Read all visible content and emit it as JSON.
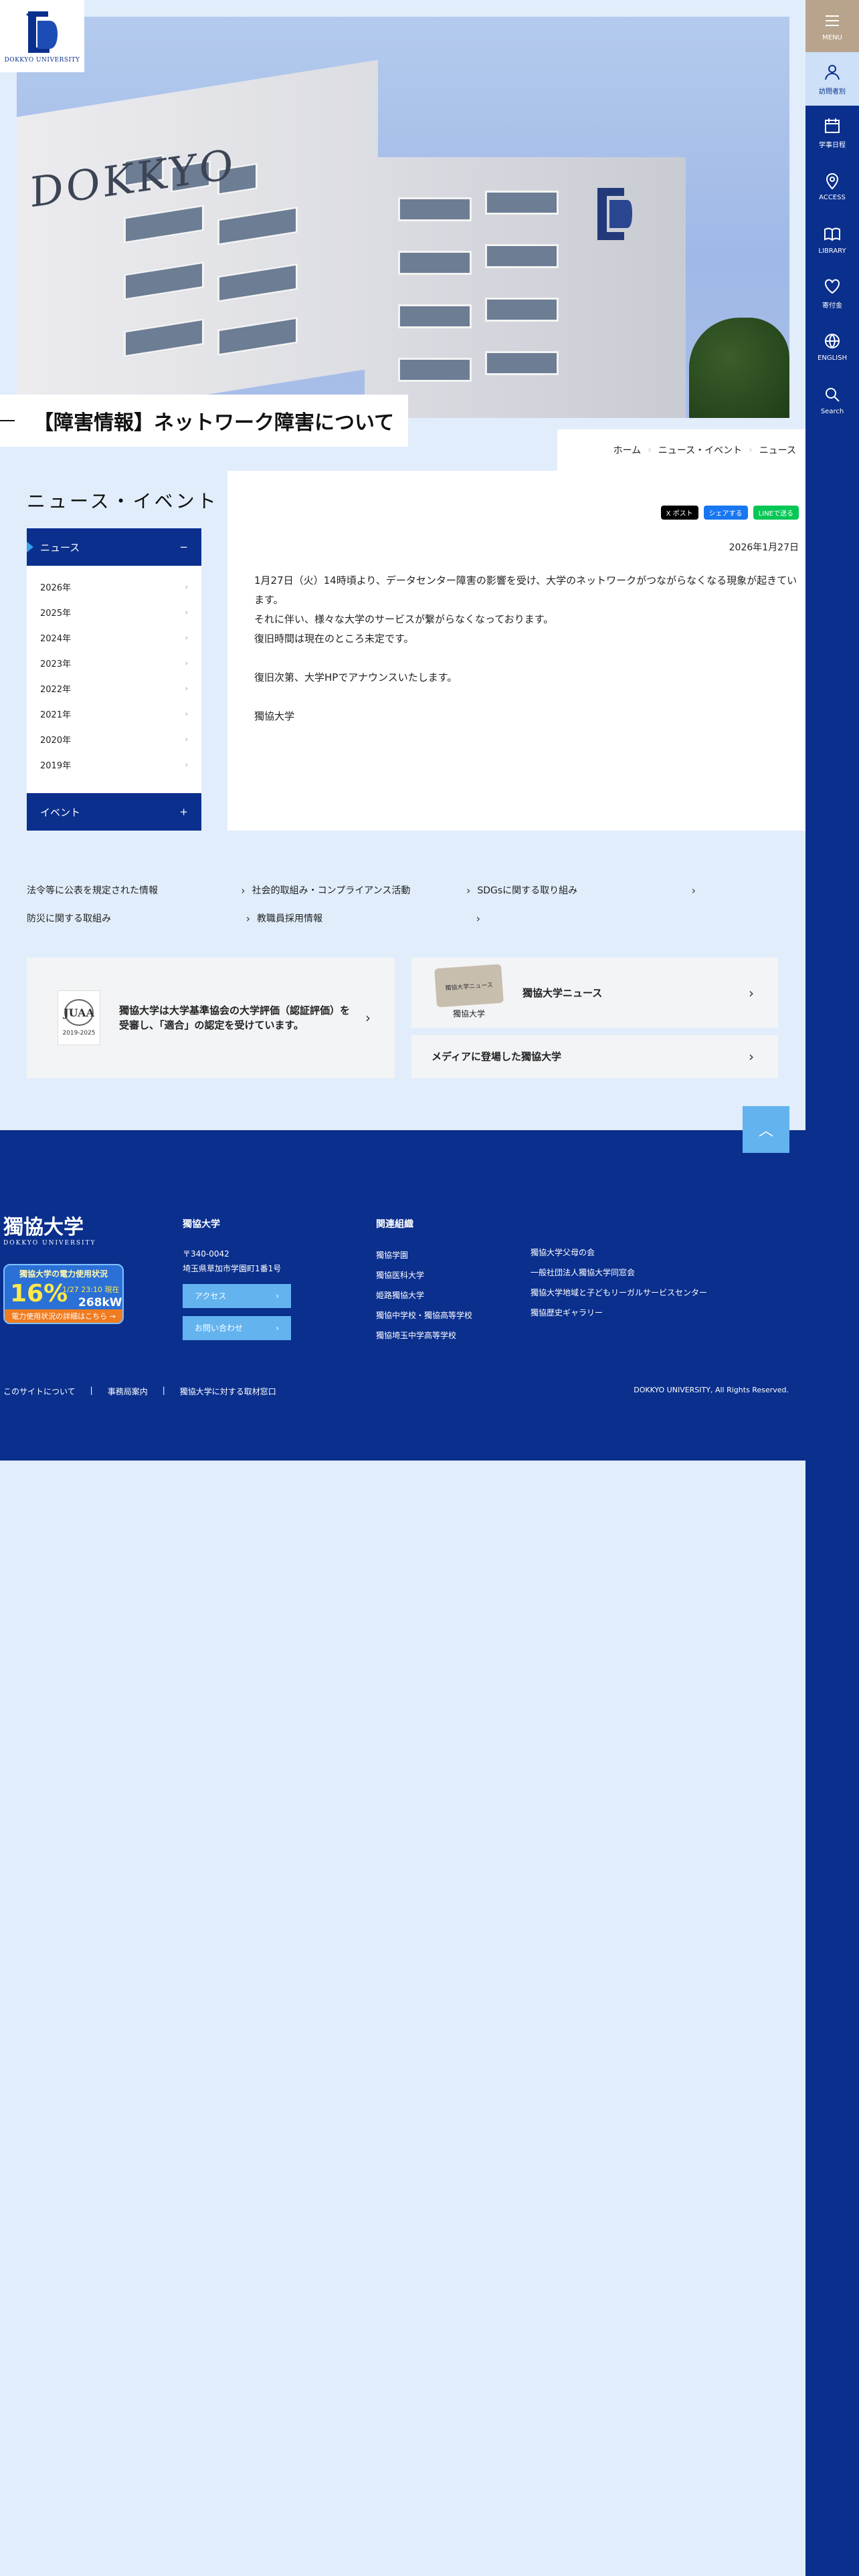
{
  "logo": {
    "text": "DOKKYO UNIVERSITY"
  },
  "nav": {
    "menu": "MENU",
    "visit": "訪問者別",
    "items": [
      "学事日程",
      "ACCESS",
      "LIBRARY",
      "寄付金",
      "ENGLISH",
      "Search"
    ]
  },
  "hero": {
    "building_text": "DOKKYO"
  },
  "page": {
    "title": "【障害情報】ネットワーク障害について"
  },
  "breadcrumb": [
    "ホーム",
    "ニュース・イベント",
    "ニュース"
  ],
  "sidebar": {
    "title": "ニュース・イベント",
    "categories": [
      {
        "label": "ニュース",
        "toggle": "−"
      },
      {
        "label": "イベント",
        "toggle": "+"
      }
    ],
    "years": [
      "2026年",
      "2025年",
      "2024年",
      "2023年",
      "2022年",
      "2021年",
      "2020年",
      "2019年"
    ]
  },
  "share": {
    "x": "X ポスト",
    "fb": "シェアする",
    "line": "LINEで送る",
    "colors": {
      "x": "#000000",
      "fb": "#1877f2",
      "line": "#06c755"
    }
  },
  "article": {
    "date": "2026年1月27日",
    "lines": [
      "1月27日（火）14時頃より、データセンター障害の影響を受け、大学のネットワークがつながらなくなる現象が起きています。",
      "それに伴い、様々な大学のサービスが繋がらなくなっております。",
      "復旧時間は現在のところ未定です。",
      "",
      "復旧次第、大学HPでアナウンスいたします。",
      "",
      "獨協大学"
    ]
  },
  "links": [
    [
      "法令等に公表を規定された情報",
      "社会的取組み・コンプライアンス活動",
      "SDGsに関する取り組み"
    ],
    [
      "防災に関する取組み",
      "教職員採用情報"
    ]
  ],
  "banners": {
    "jihee": {
      "line1": "獨協大学は大学基準協会の大学評価（認証評価）を",
      "line2": "受審し、「適合」の認定を受けています。",
      "badge": "JUAA",
      "badge_sub": "2019-2025"
    },
    "news": {
      "label": "獨協大学ニュース",
      "book_name": "獨協大学",
      "book_cover": "獨協大学ニュース"
    },
    "media": {
      "label": "メディアに登場した獨協大学"
    }
  },
  "pagetop": "︿",
  "footer": {
    "logo": "獨協大学",
    "logo_sub": "DOKKYO UNIVERSITY",
    "power": {
      "title": "獨協大学の電力使用状況",
      "percent": "16%",
      "datetime": "1/27 23:10 現在",
      "kw": "268kW",
      "detail": "電力使用状況の詳細はこちら →"
    },
    "univ_heading": "獨協大学",
    "zip": "〒340-0042",
    "address": "埼玉県草加市学園町1番1号",
    "access": "アクセス",
    "contact": "お問い合わせ",
    "related_heading": "関連組織",
    "related1": [
      "獨協学園",
      "獨協医科大学",
      "姫路獨協大学",
      "獨協中学校・獨協高等学校",
      "獨協埼玉中学高等学校"
    ],
    "related2": [
      "獨協大学父母の会",
      "一般社団法人獨協大学同窓会",
      "獨協大学地域と子どもリーガルサービスセンター",
      "獨協歴史ギャラリー"
    ],
    "bottom": [
      "このサイトについて",
      "|",
      "事務局案内",
      "|",
      "獨協大学に対する取材窓口"
    ],
    "copyright": "DOKKYO UNIVERSITY, All Rights Reserved."
  }
}
